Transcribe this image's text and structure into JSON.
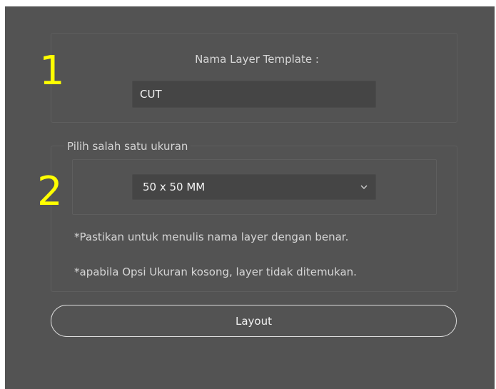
{
  "annotations": {
    "step_1": "1",
    "step_2": "2"
  },
  "layer_name_group": {
    "label": "Nama Layer Template :",
    "input_value": "CUT"
  },
  "size_group": {
    "legend": "Pilih salah satu ukuran",
    "selected_value": "50 x 50 MM",
    "notes": [
      "*Pastikan untuk menulis nama layer dengan benar.",
      "*apabila Opsi Ukuran kosong, layer tidak ditemukan."
    ]
  },
  "actions": {
    "layout_label": "Layout"
  },
  "colors": {
    "panel_background": "#535353",
    "input_background": "#454545",
    "annotation_yellow": "#ffff00"
  },
  "icons": {
    "dropdown": "chevron-down-icon"
  }
}
